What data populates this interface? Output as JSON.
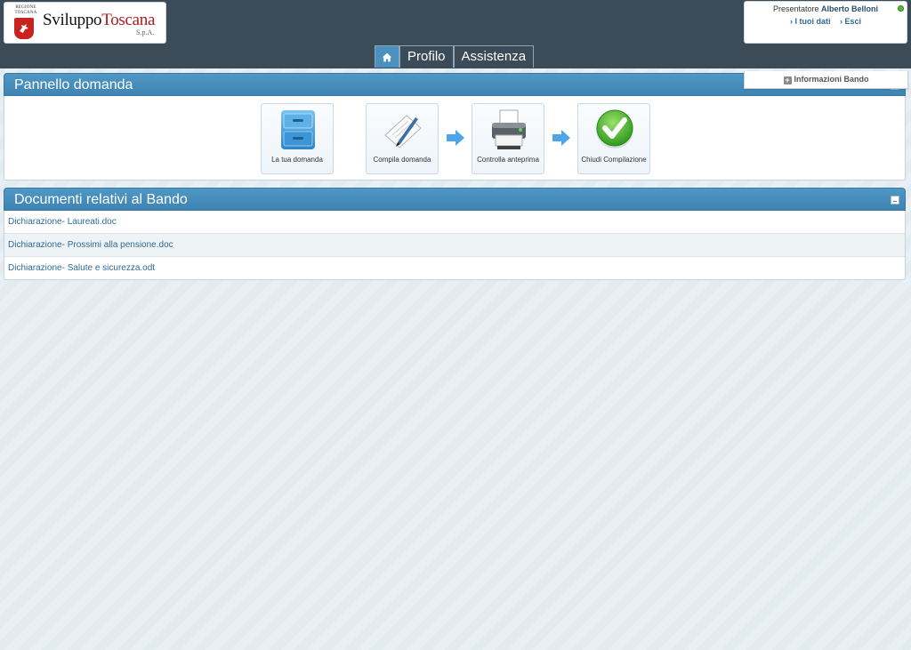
{
  "header": {
    "logo": {
      "region_text": "REGIONE TOSCANA",
      "brand_part1": "Sviluppo",
      "brand_part2": "Toscana",
      "suffix": "S.p.A."
    },
    "user": {
      "prefix": "Presentatore",
      "name": "Alberto Belloni",
      "links": [
        "› I tuoi dati",
        "› Esci"
      ]
    },
    "nav": {
      "tabs": [
        "Profilo",
        "Assistenza"
      ]
    }
  },
  "info_tab": {
    "label": "Informazioni Bando"
  },
  "panel_domanda": {
    "title": "Pannello domanda",
    "steps": [
      {
        "label": "La tua domanda",
        "icon": "file-cabinet-icon"
      },
      {
        "label": "Compila domanda",
        "icon": "pen-paper-icon"
      },
      {
        "label": "Controlla anteprima",
        "icon": "printer-icon"
      },
      {
        "label": "Chiudi Compilazione",
        "icon": "green-check-icon"
      }
    ]
  },
  "panel_documenti": {
    "title": "Documenti relativi al Bando",
    "docs": [
      "Dichiarazione- Laureati.doc",
      "Dichiarazione- Prossimi alla pensione.doc",
      "Dichiarazione- Salute e sicurezza.odt"
    ]
  },
  "colors": {
    "topbar": "#3c4b58",
    "panel_header": "#4a90c0",
    "link": "#2f6a96"
  }
}
